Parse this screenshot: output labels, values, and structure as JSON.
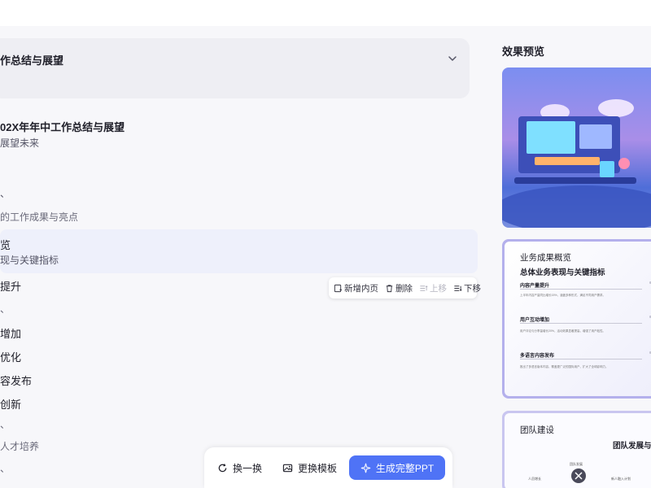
{
  "outline": {
    "section_title": "作总结与展望",
    "doc_title": "02X年年中工作总结与展望",
    "doc_subtitle": "展望未来",
    "section_marker": "、",
    "section_label": "的工作成果与亮点",
    "highlight": {
      "title": "览",
      "subtitle": "现与关键指标"
    },
    "items": [
      "提升",
      "、",
      "增加",
      "优化",
      "容发布",
      "创新"
    ],
    "section2_marker": "、",
    "section2_label": "人才培养",
    "last_marker": "、"
  },
  "toolbar": {
    "add_page": "新增内页",
    "delete": "删除",
    "move_up": "上移",
    "move_down": "下移"
  },
  "actions": {
    "shuffle": "换一换",
    "change_template": "更换模板",
    "generate": "生成完整PPT"
  },
  "preview": {
    "title": "效果预览",
    "slide2": {
      "title": "业务成果概览",
      "subtitle": "总体业务表现与关键指标",
      "blocks": [
        {
          "heading": "内容产量提升",
          "text": "上半年内容产量同比增长15%，涵盖多种形式，满足不同用户需求。"
        },
        {
          "heading": "用户互动增加",
          "text": "用户评论与分享量增长20%，活动效果显著提高，增强了用户粘性。"
        },
        {
          "heading": "多语言内容发布",
          "text": "推出了多语言版本内容，覆盖更广泛的国际用户，扩大了全球影响力。"
        }
      ]
    },
    "slide3": {
      "title": "团队建设",
      "subtitle": "团队发展与人",
      "nodes": [
        "人员增长",
        "团队发展",
        "新人融入计划"
      ]
    }
  },
  "colors": {
    "accent": "#4f73f6",
    "highlight_bg": "#eef0fb",
    "panel_bg": "#eeeef3"
  }
}
